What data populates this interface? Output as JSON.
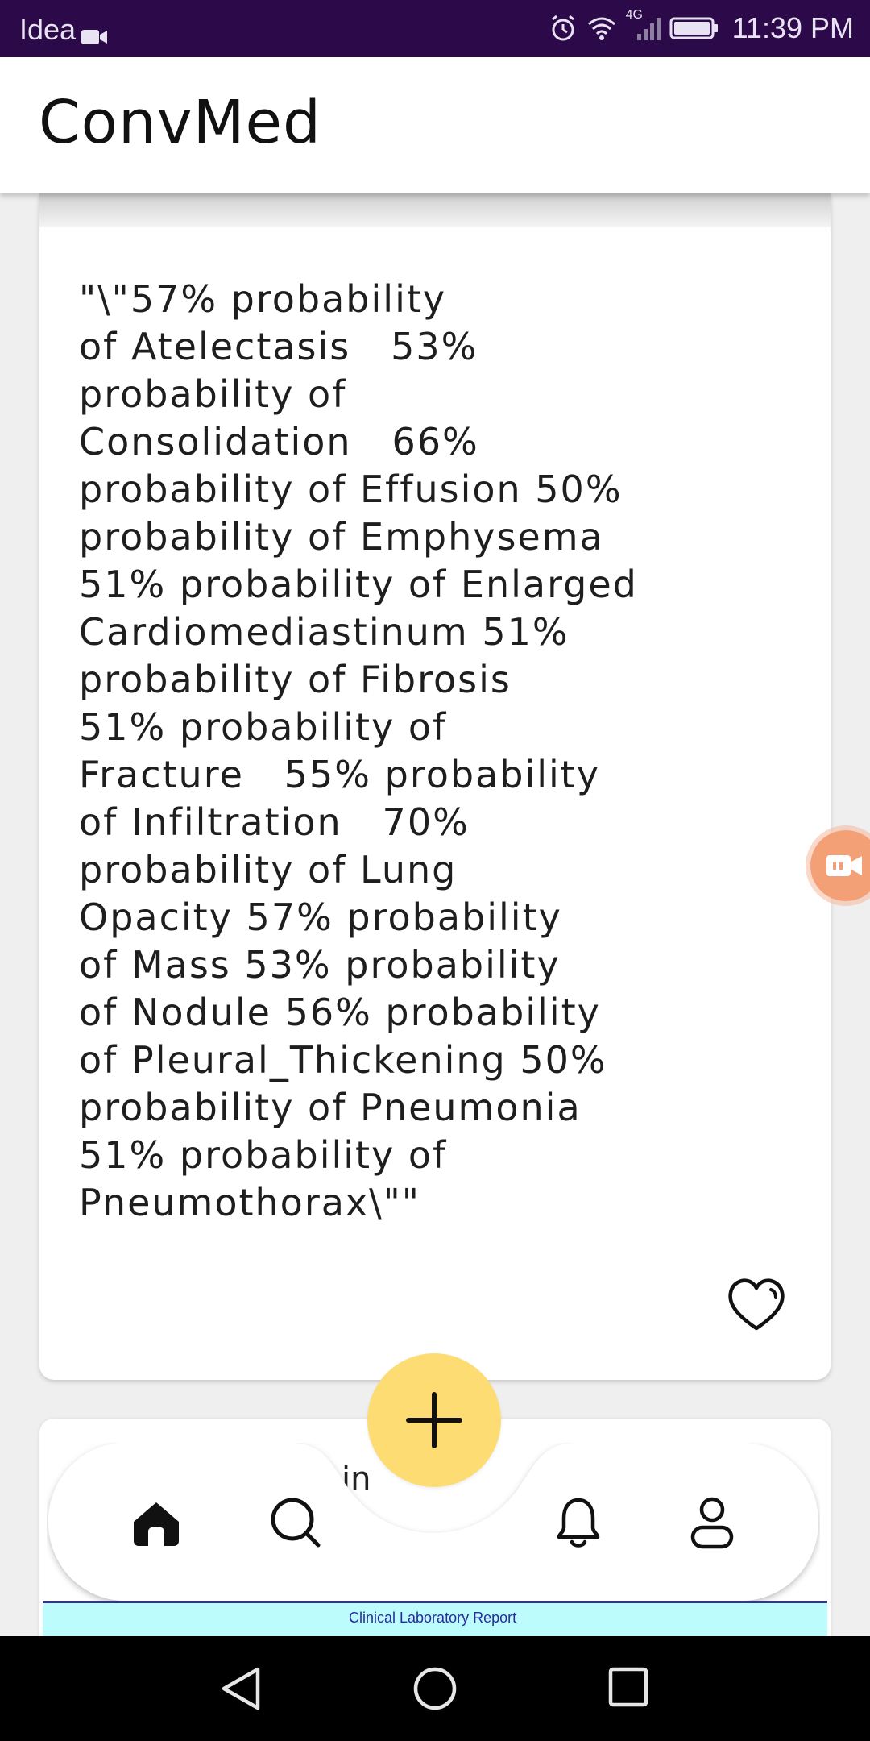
{
  "status_bar": {
    "carrier": "Idea",
    "time": "11:39 PM",
    "network": "4G",
    "icons": [
      "video-icon",
      "alarm-icon",
      "wifi-icon",
      "signal-icon",
      "battery-icon"
    ]
  },
  "app_bar": {
    "title": "ConvMed"
  },
  "result_card": {
    "prediction_text": "\"\\\"57% probability\nof Atelectasis   53%\nprobability of\nConsolidation   66%\nprobability of Effusion 50%\nprobability of Emphysema\n51% probability of Enlarged\nCardiomediastinum 51%\nprobability of Fibrosis\n51% probability of\nFracture   55% probability\nof Infiltration   70%\nprobability of Lung\nOpacity 57% probability\nof Mass 53% probability\nof Nodule 56% probability\nof Pleural_Thickening 50%\nprobability of Pneumonia\n51% probability of\nPneumothorax\\\"\"",
    "like_icon": "heart-icon"
  },
  "next_card": {
    "partial_text": "in",
    "report_title": "Clinical Laboratory Report"
  },
  "bottom_nav": {
    "items": [
      {
        "name": "home",
        "icon": "home-icon"
      },
      {
        "name": "search",
        "icon": "search-icon"
      },
      {
        "name": "notifications",
        "icon": "bell-icon"
      },
      {
        "name": "profile",
        "icon": "user-icon"
      }
    ],
    "fab_icon": "plus-icon"
  },
  "colors": {
    "status_bar": "#2c0a4a",
    "fab": "#fddc74",
    "background": "#efefef",
    "record_bubble": "#f3a077"
  }
}
